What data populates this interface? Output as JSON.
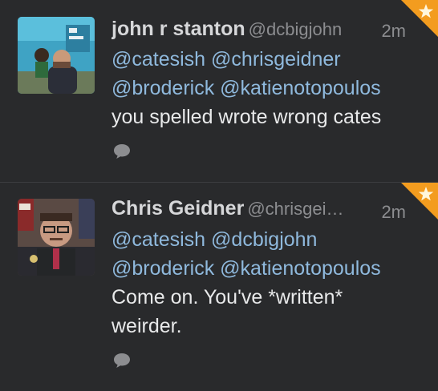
{
  "tweets": [
    {
      "name": "john r stanton",
      "handle": "@dcbigjohn",
      "time": "2m",
      "lines": [
        [
          {
            "text": "@catesish",
            "mention": true
          },
          {
            "text": " ",
            "mention": false
          },
          {
            "text": "@chrisgeidner",
            "mention": true
          }
        ],
        [
          {
            "text": "@broderick",
            "mention": true
          },
          {
            "text": " ",
            "mention": false
          },
          {
            "text": "@katienotopoulos",
            "mention": true
          }
        ],
        [
          {
            "text": "you spelled wrote wrong cates",
            "mention": false
          }
        ]
      ],
      "avatar_icon": "user-avatar-photo",
      "reply_icon": "reply-speech-bubble-icon",
      "corner_icon": "favorite-star-icon"
    },
    {
      "name": "Chris Geidner",
      "handle": "@chrisgei…",
      "time": "2m",
      "lines": [
        [
          {
            "text": "@catesish",
            "mention": true
          },
          {
            "text": " ",
            "mention": false
          },
          {
            "text": "@dcbigjohn",
            "mention": true
          }
        ],
        [
          {
            "text": "@broderick",
            "mention": true
          },
          {
            "text": " ",
            "mention": false
          },
          {
            "text": "@katienotopoulos",
            "mention": true
          }
        ],
        [
          {
            "text": "Come on. You've *written*",
            "mention": false
          }
        ],
        [
          {
            "text": "weirder.",
            "mention": false
          }
        ]
      ],
      "avatar_icon": "user-avatar-photo",
      "reply_icon": "reply-speech-bubble-icon",
      "corner_icon": "favorite-star-icon"
    }
  ],
  "colors": {
    "background": "#292a2c",
    "name": "#d6d7d9",
    "handle": "#8c8d90",
    "mention": "#8fb9dd",
    "body_text": "#e8e9ea",
    "corner_orange": "#f39c1f"
  }
}
